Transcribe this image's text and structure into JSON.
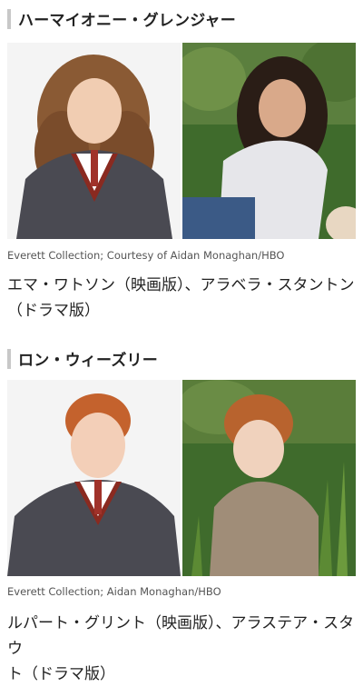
{
  "sections": [
    {
      "title": "ハーマイオニー・グレンジャー",
      "credit": "Everett Collection; Courtesy of Aidan Monaghan/HBO",
      "caption_line1": "エマ・ワトソン（映画版）、アラベラ・スタントン",
      "caption_line2": "（ドラマ版）"
    },
    {
      "title": "ロン・ウィーズリー",
      "credit": "Everett Collection; Aidan Monaghan/HBO",
      "caption_line1": "ルパート・グリント（映画版）、アラステア・スタウ",
      "caption_line2": "ト（ドラマ版）"
    }
  ],
  "colors": {
    "heading_bar": "#c8c8c8",
    "studio_bg": "#f4f4f4",
    "grass_green": "#3f6b2c",
    "sweater_gray": "#4a4a52",
    "house_stripe": "#8a2a20"
  }
}
